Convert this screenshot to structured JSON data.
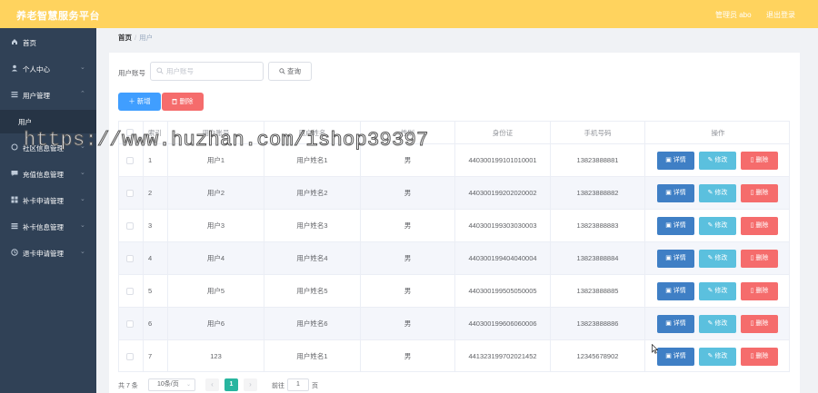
{
  "app": {
    "title": "养老智慧服务平台",
    "admin_label": "管理员 abo",
    "logout_label": "退出登录"
  },
  "sidebar": {
    "items": [
      {
        "label": "首页",
        "icon": "home-icon"
      },
      {
        "label": "个人中心",
        "icon": "user-icon"
      },
      {
        "label": "用户管理",
        "icon": "list-icon"
      },
      {
        "label": "用户",
        "sub": true
      },
      {
        "label": "社区信息管理",
        "icon": "bell-icon"
      },
      {
        "label": "充值信息管理",
        "icon": "chat-icon"
      },
      {
        "label": "补卡申请管理",
        "icon": "grid-icon"
      },
      {
        "label": "补卡信息管理",
        "icon": "grid-icon"
      },
      {
        "label": "退卡申请管理",
        "icon": "clock-icon"
      }
    ]
  },
  "breadcrumb": {
    "home": "首页",
    "separator": "/",
    "current": "用户"
  },
  "search": {
    "label": "用户账号",
    "placeholder": "用户账号",
    "query_label": "查询"
  },
  "actions": {
    "add_label": "新增",
    "delete_label": "删除"
  },
  "table": {
    "headers": {
      "index": "索引",
      "account": "用户账号",
      "name": "用户姓名",
      "sex": "性别",
      "id_card": "身份证",
      "phone": "手机号码",
      "ops": "操作"
    },
    "op_labels": {
      "detail": "详情",
      "edit": "修改",
      "delete": "删除"
    },
    "rows": [
      {
        "index": "1",
        "account": "用户1",
        "name": "用户姓名1",
        "sex": "男",
        "id_card": "440300199101010001",
        "phone": "13823888881"
      },
      {
        "index": "2",
        "account": "用户2",
        "name": "用户姓名2",
        "sex": "男",
        "id_card": "440300199202020002",
        "phone": "13823888882"
      },
      {
        "index": "3",
        "account": "用户3",
        "name": "用户姓名3",
        "sex": "男",
        "id_card": "440300199303030003",
        "phone": "13823888883"
      },
      {
        "index": "4",
        "account": "用户4",
        "name": "用户姓名4",
        "sex": "男",
        "id_card": "440300199404040004",
        "phone": "13823888884"
      },
      {
        "index": "5",
        "account": "用户5",
        "name": "用户姓名5",
        "sex": "男",
        "id_card": "440300199505050005",
        "phone": "13823888885"
      },
      {
        "index": "6",
        "account": "用户6",
        "name": "用户姓名6",
        "sex": "男",
        "id_card": "440300199606060006",
        "phone": "13823888886"
      },
      {
        "index": "7",
        "account": "123",
        "name": "用户姓名1",
        "sex": "男",
        "id_card": "441323199702021452",
        "phone": "12345678902"
      }
    ]
  },
  "pagination": {
    "total": "共 7 条",
    "page_size": "10条/页",
    "current_page": "1",
    "goto_label": "前往",
    "goto_value": "1",
    "page_suffix": "页"
  },
  "watermark": "https://www.huzhan.com/ishop39397",
  "colors": {
    "header": "#ffd35e",
    "sidebar": "#304156",
    "primary": "#409eff",
    "danger": "#f56c6c",
    "info": "#5bc0de",
    "detail": "#3f7fc5",
    "page_active": "#28b59f"
  }
}
